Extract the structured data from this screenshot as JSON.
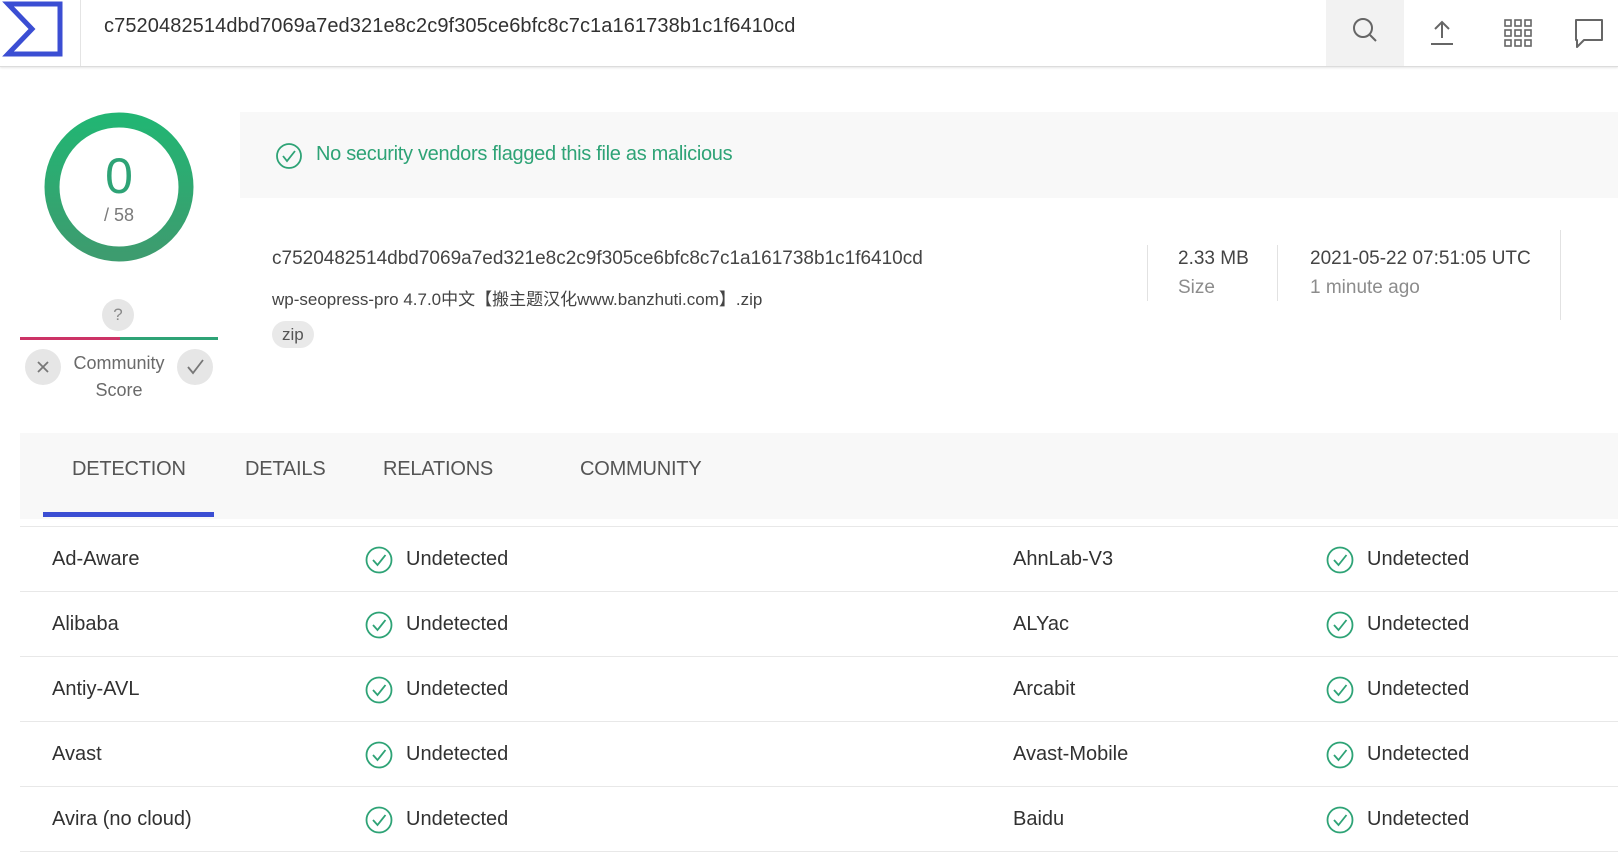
{
  "search": {
    "query": "c7520482514dbd7069a7ed321e8c2c9f305ce6bfc8c7c1a161738b1c1f6410cd"
  },
  "toolbar": {
    "icons": [
      "search-icon",
      "upload-icon",
      "grid-icon",
      "chat-icon"
    ]
  },
  "score": {
    "detections": "0",
    "total": "/ 58",
    "color": "#2ea376"
  },
  "community": {
    "unknown": "?",
    "label": "Community Score"
  },
  "banner": {
    "text": "No security vendors flagged this file as malicious",
    "color": "#2ea376"
  },
  "file": {
    "hash": "c7520482514dbd7069a7ed321e8c2c9f305ce6bfc8c7c1a161738b1c1f6410cd",
    "name": "wp-seopress-pro 4.7.0中文【搬主题汉化www.banzhuti.com】.zip",
    "tag": "zip",
    "size_value": "2.33 MB",
    "size_label": "Size",
    "date_value": "2021-05-22 07:51:05 UTC",
    "date_label": "1 minute ago"
  },
  "tabs": [
    "DETECTION",
    "DETAILS",
    "RELATIONS",
    "COMMUNITY"
  ],
  "active_tab": "DETECTION",
  "detections": [
    {
      "left_vendor": "Ad-Aware",
      "left_result": "Undetected",
      "right_vendor": "AhnLab-V3",
      "right_result": "Undetected"
    },
    {
      "left_vendor": "Alibaba",
      "left_result": "Undetected",
      "right_vendor": "ALYac",
      "right_result": "Undetected"
    },
    {
      "left_vendor": "Antiy-AVL",
      "left_result": "Undetected",
      "right_vendor": "Arcabit",
      "right_result": "Undetected"
    },
    {
      "left_vendor": "Avast",
      "left_result": "Undetected",
      "right_vendor": "Avast-Mobile",
      "right_result": "Undetected"
    },
    {
      "left_vendor": "Avira (no cloud)",
      "left_result": "Undetected",
      "right_vendor": "Baidu",
      "right_result": "Undetected"
    }
  ]
}
